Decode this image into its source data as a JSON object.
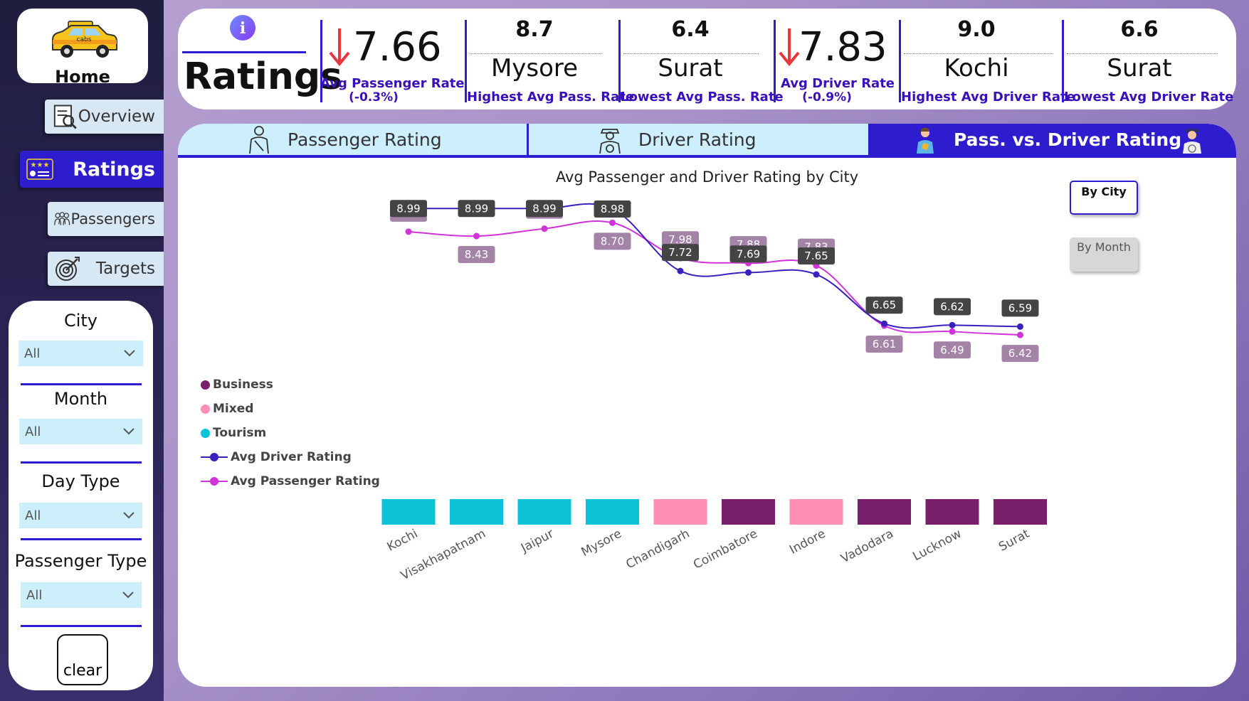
{
  "nav": {
    "home_label": "Home",
    "taxi_brand": "cabs",
    "items": [
      {
        "label": "Overview",
        "icon": "report-icon"
      },
      {
        "label": "Ratings",
        "icon": "rating-card-icon"
      },
      {
        "label": "Passengers",
        "icon": "passengers-icon"
      },
      {
        "label": "Targets",
        "icon": "target-icon"
      }
    ]
  },
  "filters": {
    "city": {
      "label": "City",
      "value": "All"
    },
    "month": {
      "label": "Month",
      "value": "All"
    },
    "day_type": {
      "label": "Day Type",
      "value": "All"
    },
    "passenger_type": {
      "label": "Passenger Type",
      "value": "All"
    },
    "clear_label": "clear"
  },
  "kpis": {
    "page_title": "Ratings",
    "info_symbol": "i",
    "avg_passenger_rate": {
      "value": "7.66",
      "label": "Avg Passenger Rate",
      "delta": "(-0.3%)"
    },
    "highest_pass": {
      "value": "8.7",
      "city": "Mysore",
      "label": "Highest Avg Pass. Rate"
    },
    "lowest_pass": {
      "value": "6.4",
      "city": "Surat",
      "label": "Lowest Avg Pass. Rate"
    },
    "avg_driver_rate": {
      "value": "7.83",
      "label": "Avg Driver Rate",
      "delta": "(-0.9%)"
    },
    "highest_driver": {
      "value": "9.0",
      "city": "Kochi",
      "label": "Highest Avg Driver Rate"
    },
    "lowest_driver": {
      "value": "6.6",
      "city": "Surat",
      "label": "Lowest Avg Driver Rate"
    }
  },
  "tabs": [
    {
      "label": "Passenger Rating",
      "active": false
    },
    {
      "label": "Driver Rating",
      "active": false
    },
    {
      "label": "Pass. vs. Driver Rating",
      "active": true
    }
  ],
  "toggles": {
    "by_city": "By City",
    "by_month": "By Month"
  },
  "colors": {
    "accent": "#2e1ccf",
    "driver_line": "#3a1fbf",
    "passenger_line": "#d033d8",
    "business": "#78206c",
    "mixed": "#ff8fb4",
    "tourism": "#0bc2d6",
    "driver_label_bg": "#444444",
    "passenger_label_bg": "#a383a6",
    "down_arrow": "#e8363f"
  },
  "chart_data": {
    "type": "line",
    "title": "Avg Passenger and Driver Rating by City",
    "categories": [
      "Kochi",
      "Visakhapatnam",
      "Jaipur",
      "Mysore",
      "Chandigarh",
      "Coimbatore",
      "Indore",
      "Vadodara",
      "Lucknow",
      "Surat"
    ],
    "city_type": [
      "Tourism",
      "Tourism",
      "Tourism",
      "Tourism",
      "Mixed",
      "Business",
      "Mixed",
      "Business",
      "Business",
      "Business"
    ],
    "legend": [
      "Business",
      "Mixed",
      "Tourism",
      "Avg Driver Rating",
      "Avg Passenger Rating"
    ],
    "legend_position": "left",
    "series": [
      {
        "name": "Avg Driver Rating",
        "values": [
          8.99,
          8.99,
          8.99,
          8.98,
          7.72,
          7.69,
          7.65,
          6.65,
          6.62,
          6.59
        ]
      },
      {
        "name": "Avg Passenger Rating",
        "values": [
          8.52,
          8.43,
          8.58,
          8.7,
          7.98,
          7.88,
          7.83,
          6.61,
          6.49,
          6.42
        ]
      }
    ],
    "y_range": [
      6.3,
      9.1
    ],
    "grid": false
  }
}
